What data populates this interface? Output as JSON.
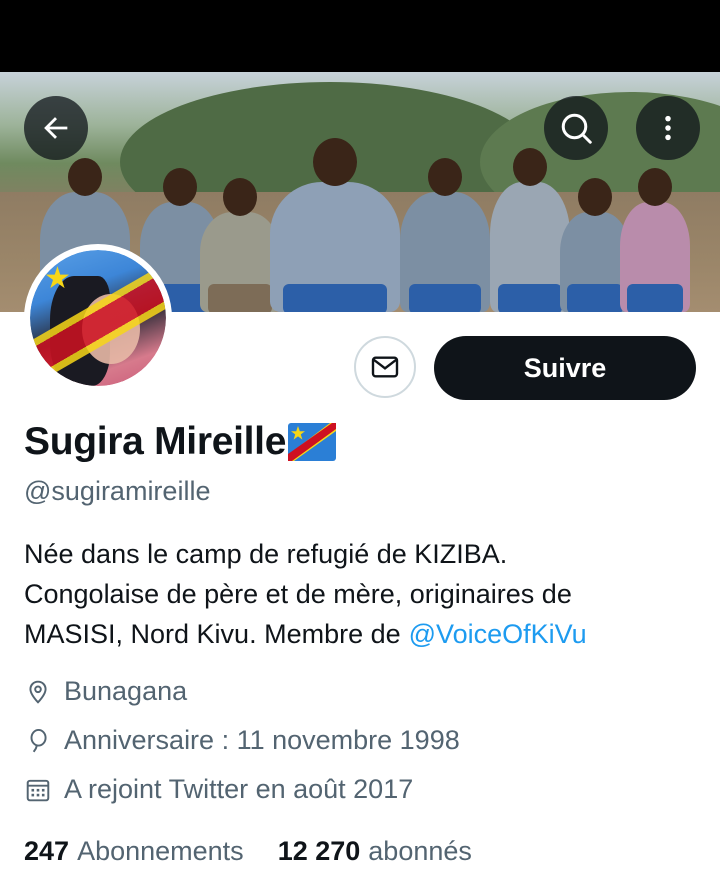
{
  "profile": {
    "display_name": "Sugira Mireille",
    "handle": "@sugiramireille",
    "bio_lines": [
      "Née dans le camp de refugié de KIZIBA.",
      "Congolaise de père et de mère, originaires de",
      "MASISI, Nord Kivu. Membre de"
    ],
    "bio_mention": "@VoiceOfKiVu",
    "location": "Bunagana",
    "birthday": "Anniversaire : 11 novembre 1998",
    "joined": "A rejoint Twitter en août 2017",
    "following_count": "247",
    "following_label": "Abonnements",
    "followers_count": "12 270",
    "followers_label": "abonnés"
  },
  "actions": {
    "follow_label": "Suivre"
  },
  "icons": {
    "back": "arrow-left-icon",
    "search": "search-icon",
    "more": "more-vertical-icon",
    "message": "envelope-icon",
    "location": "location-pin-icon",
    "birthday": "balloon-icon",
    "joined": "calendar-icon",
    "flag": "drc-flag-icon"
  },
  "colors": {
    "accent": "#1d9bf0",
    "text": "#0f1419",
    "muted": "#536471",
    "button_bg": "#0f1419"
  }
}
